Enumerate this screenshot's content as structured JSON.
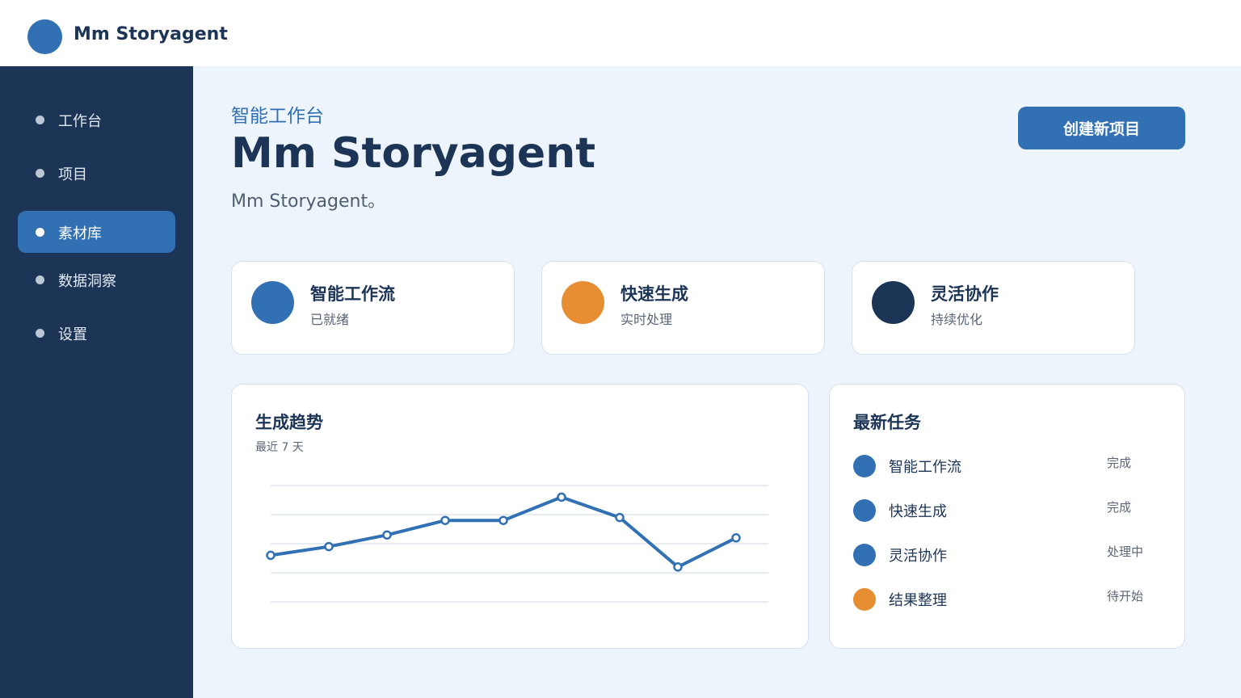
{
  "app": {
    "brand": "Mm Storyagent"
  },
  "colors": {
    "accent": "#3070b3",
    "navy": "#1c3557",
    "orange": "#e88e32",
    "background": "#eef4fb"
  },
  "sidebar": {
    "items": [
      {
        "label": "工作台",
        "active": false
      },
      {
        "label": "项目",
        "active": false
      },
      {
        "label": "素材库",
        "active": true
      },
      {
        "label": "数据洞察",
        "active": false
      },
      {
        "label": "设置",
        "active": false
      }
    ]
  },
  "header": {
    "eyebrow": "智能工作台",
    "title": "Mm Storyagent",
    "subtitle": "Mm Storyagent。",
    "create_button": "创建新项目"
  },
  "features": [
    {
      "title": "智能工作流",
      "subtitle": "已就绪",
      "color": "#3070b3"
    },
    {
      "title": "快速生成",
      "subtitle": "实时处理",
      "color": "#e88e32"
    },
    {
      "title": "灵活协作",
      "subtitle": "持续优化",
      "color": "#1c3557"
    }
  ],
  "trend": {
    "title": "生成趋势",
    "subtitle": "最近 7 天"
  },
  "chart_data": {
    "type": "line",
    "title": "生成趋势",
    "subtitle": "最近 7 天",
    "x": [
      1,
      2,
      3,
      4,
      5,
      6,
      7,
      8,
      9
    ],
    "series": [
      {
        "values": [
          56,
          59,
          63,
          68,
          68,
          76,
          69,
          52,
          62
        ]
      }
    ],
    "ylim": [
      40,
      80
    ],
    "grid": true,
    "color": "#3070b3"
  },
  "tasks": {
    "title": "最新任务",
    "items": [
      {
        "label": "智能工作流",
        "status": "完成",
        "color": "#3070b3"
      },
      {
        "label": "快速生成",
        "status": "完成",
        "color": "#3070b3"
      },
      {
        "label": "灵活协作",
        "status": "处理中",
        "color": "#3070b3"
      },
      {
        "label": "结果整理",
        "status": "待开始",
        "color": "#e88e32"
      }
    ]
  }
}
